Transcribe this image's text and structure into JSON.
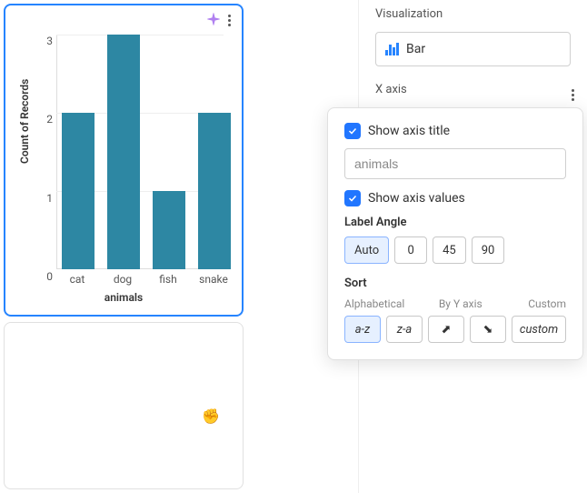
{
  "chart_data": {
    "type": "bar",
    "categories": [
      "cat",
      "dog",
      "fish",
      "snake"
    ],
    "values": [
      2,
      3,
      1,
      2
    ],
    "title": "",
    "xlabel": "animals",
    "ylabel": "Count of Records",
    "ylim": [
      0,
      3
    ],
    "yticks": [
      0,
      1,
      2,
      3
    ]
  },
  "config": {
    "visualization": {
      "header": "Visualization",
      "selected": "Bar"
    },
    "xaxis": {
      "header": "X axis",
      "show_title_label": "Show axis title",
      "show_title_checked": true,
      "title_value": "animals",
      "show_values_label": "Show axis values",
      "show_values_checked": true,
      "label_angle": {
        "label": "Label Angle",
        "options": [
          "Auto",
          "0",
          "45",
          "90"
        ],
        "selected": "Auto"
      },
      "sort": {
        "label": "Sort",
        "headers": [
          "Alphabetical",
          "By Y axis",
          "Custom"
        ],
        "options": {
          "alpha_asc": "a-z",
          "alpha_desc": "z-a",
          "custom": "custom"
        },
        "selected": "a-z"
      }
    }
  }
}
